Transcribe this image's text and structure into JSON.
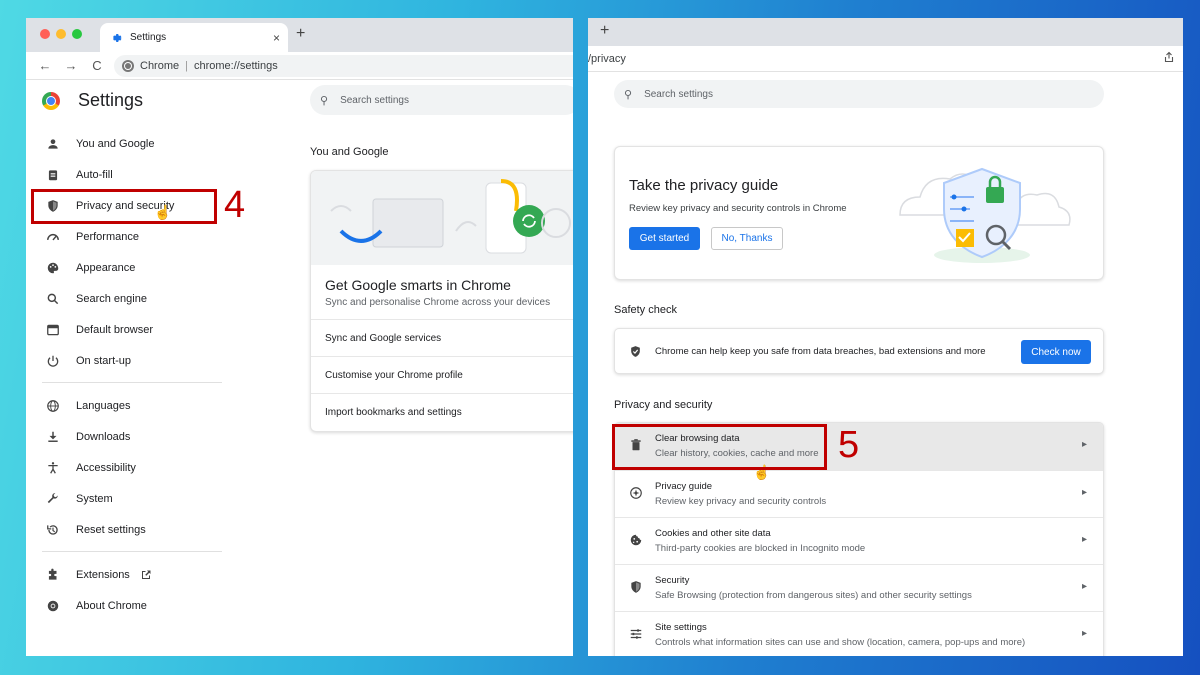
{
  "left": {
    "tab_title": "Settings",
    "tab_close": "×",
    "new_tab": "+",
    "nav_back": "←",
    "nav_forward": "→",
    "nav_reload": "C",
    "omnibox_site": "Chrome",
    "omnibox_sep": "|",
    "omnibox_url": "chrome://settings",
    "settings_title": "Settings",
    "search_placeholder": "Search settings",
    "nav_items": [
      {
        "label": "You and Google",
        "icon": "person-icon"
      },
      {
        "label": "Auto-fill",
        "icon": "clipboard-icon"
      },
      {
        "label": "Privacy and security",
        "icon": "shield-icon"
      },
      {
        "label": "Performance",
        "icon": "speedometer-icon"
      },
      {
        "label": "Appearance",
        "icon": "palette-icon"
      },
      {
        "label": "Search engine",
        "icon": "search-icon"
      },
      {
        "label": "Default browser",
        "icon": "browser-icon"
      },
      {
        "label": "On start-up",
        "icon": "power-icon"
      },
      {
        "label": "Languages",
        "icon": "globe-icon"
      },
      {
        "label": "Downloads",
        "icon": "download-icon"
      },
      {
        "label": "Accessibility",
        "icon": "accessibility-icon"
      },
      {
        "label": "System",
        "icon": "wrench-icon"
      },
      {
        "label": "Reset settings",
        "icon": "restore-icon"
      },
      {
        "label": "Extensions",
        "icon": "puzzle-icon"
      },
      {
        "label": "About Chrome",
        "icon": "chrome-icon"
      }
    ],
    "section_you_and_google": "You and Google",
    "card_heading": "Get Google smarts in Chrome",
    "card_sub": "Sync and personalise Chrome across your devices",
    "card_rows": [
      "Sync and Google services",
      "Customise your Chrome profile",
      "Import bookmarks and settings"
    ],
    "step_label": "4"
  },
  "right": {
    "new_tab": "+",
    "url_fragment": "/privacy",
    "search_placeholder": "Search settings",
    "privacy_guide_title": "Take the privacy guide",
    "privacy_guide_sub": "Review key privacy and security controls in Chrome",
    "get_started": "Get started",
    "no_thanks": "No, Thanks",
    "safety_check_title": "Safety check",
    "safety_check_text": "Chrome can help keep you safe from data breaches, bad extensions and more",
    "check_now": "Check now",
    "privacy_section_title": "Privacy and security",
    "rows": [
      {
        "title": "Clear browsing data",
        "sub": "Clear history, cookies, cache and more",
        "icon": "trash-icon"
      },
      {
        "title": "Privacy guide",
        "sub": "Review key privacy and security controls",
        "icon": "compass-icon"
      },
      {
        "title": "Cookies and other site data",
        "sub": "Third-party cookies are blocked in Incognito mode",
        "icon": "cookie-icon"
      },
      {
        "title": "Security",
        "sub": "Safe Browsing (protection from dangerous sites) and other security settings",
        "icon": "shield-icon"
      },
      {
        "title": "Site settings",
        "sub": "Controls what information sites can use and show (location, camera, pop-ups and more)",
        "icon": "sliders-icon"
      }
    ],
    "step_label": "5"
  },
  "colors": {
    "accent": "#1a73e8",
    "highlight": "#c00000",
    "traffic_red": "#ff5f57",
    "traffic_yellow": "#febc2e",
    "traffic_green": "#28c840"
  }
}
